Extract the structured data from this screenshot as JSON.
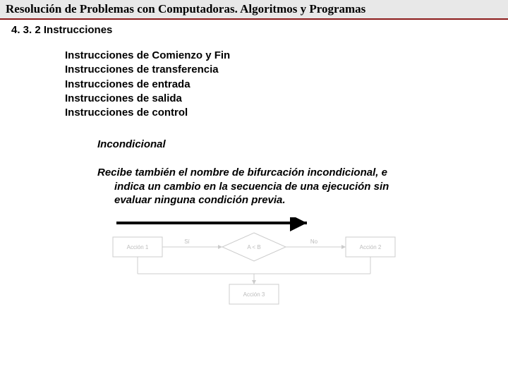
{
  "header": {
    "title": "Resolución de Problemas con Computadoras. Algoritmos y Programas"
  },
  "section": {
    "number_title": "4. 3. 2 Instrucciones"
  },
  "bullets": {
    "item1": "Instrucciones de Comienzo y Fin",
    "item2": "Instrucciones de transferencia",
    "item3": "Instrucciones de entrada",
    "item4": "Instrucciones de salida",
    "item5": "Instrucciones de control"
  },
  "sub": {
    "heading": "Incondicional",
    "line1": "Recibe también el nombre de bifurcación incondicional, e",
    "line2": "indica un cambio en la secuencia de una ejecución sin",
    "line3": "evaluar ninguna condición previa."
  },
  "diagram": {
    "box_left": "Acción 1",
    "diamond": "A < B",
    "box_right": "Acción 2",
    "box_bottom": "Acción 3",
    "edge_si": "Sí",
    "edge_no": "No"
  }
}
